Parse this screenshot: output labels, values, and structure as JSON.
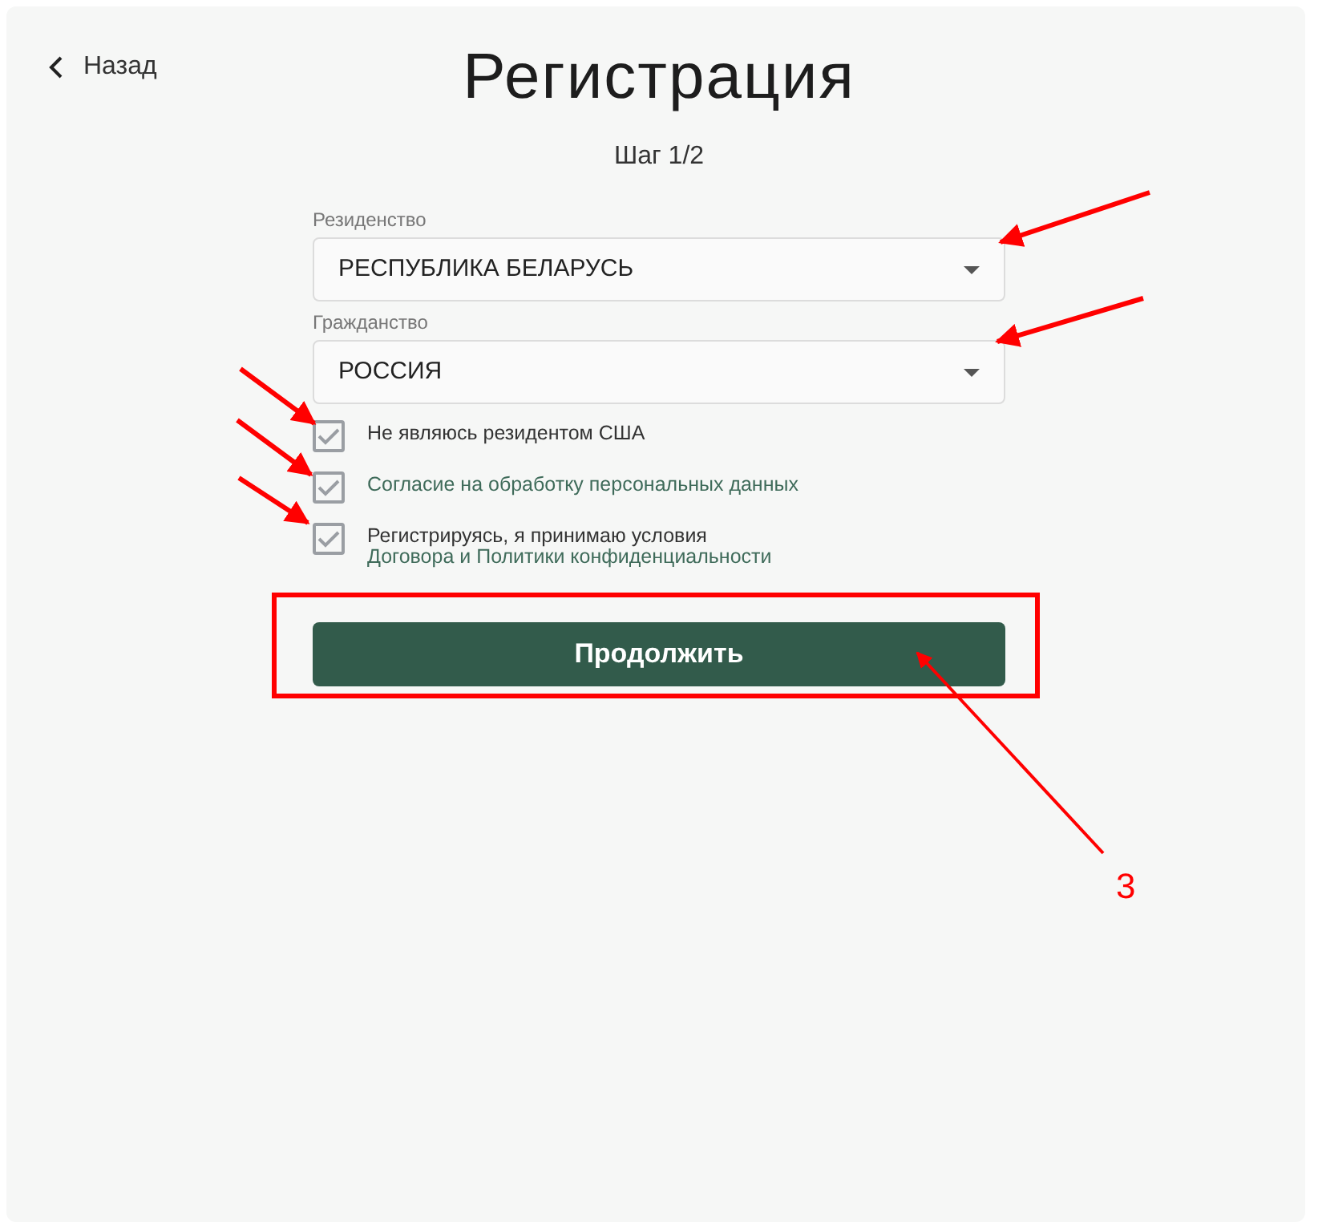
{
  "back_link": {
    "label": "Назад"
  },
  "title": "Регистрация",
  "step": "Шаг 1/2",
  "selects": [
    {
      "label": "Резиденство",
      "value": "РЕСПУБЛИКА БЕЛАРУСЬ"
    },
    {
      "label": "Гражданство",
      "value": "РОССИЯ"
    }
  ],
  "checkboxes": [
    {
      "checked": true,
      "parts": [
        {
          "text": "Не являюсь резидентом США",
          "link": false
        }
      ]
    },
    {
      "checked": true,
      "parts": [
        {
          "text": "Согласие на обработку персональных данных",
          "link": true
        }
      ]
    },
    {
      "checked": true,
      "parts": [
        {
          "text": "Регистрируясь, я принимаю условия ",
          "link": false
        },
        {
          "text": "Договора и Политики ",
          "link": true
        },
        {
          "text": "конфиденциальности",
          "link": true
        }
      ]
    }
  ],
  "continue_button": "Продолжить",
  "annotation": {
    "number": "3"
  }
}
